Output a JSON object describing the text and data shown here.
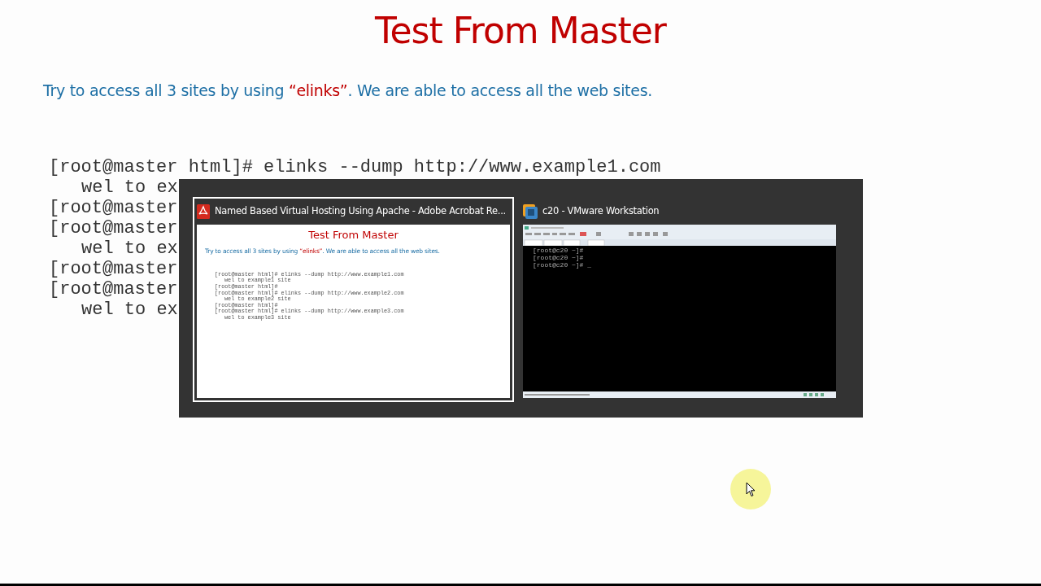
{
  "slide": {
    "title": "Test From Master",
    "subtitle": [
      {
        "text": "Try to access all 3 sites by using ",
        "highlight": false
      },
      {
        "text": "“elinks”",
        "highlight": true
      },
      {
        "text": ". We are able to access all the web sites.",
        "highlight": false
      }
    ],
    "terminal_lines": [
      {
        "text": "[root@master html]# elinks --dump http://www.example1.com",
        "indent": false
      },
      {
        "text": "wel to ex",
        "indent": true
      },
      {
        "text": "[root@master",
        "indent": false
      },
      {
        "text": "[root@master",
        "indent": false
      },
      {
        "text": "wel to ex",
        "indent": true
      },
      {
        "text": "[root@master",
        "indent": false
      },
      {
        "text": "[root@master",
        "indent": false
      },
      {
        "text": "wel to ex",
        "indent": true
      }
    ]
  },
  "task_switcher": {
    "windows": [
      {
        "kind": "pdf",
        "title": "Named Based Virtual Hosting Using Apache - Adobe Acrobat Re...",
        "selected": true,
        "preview": {
          "title": "Test From Master",
          "subtitle": [
            {
              "text": "Try to access all 3 sites by using ",
              "highlight": false
            },
            {
              "text": "“elinks”",
              "highlight": true
            },
            {
              "text": ". We are able to access all the web sites.",
              "highlight": false
            }
          ],
          "lines": [
            {
              "text": "[root@master html]# elinks --dump http://www.example1.com",
              "indent": false
            },
            {
              "text": "wel to example1 site",
              "indent": true
            },
            {
              "text": "[root@master html]#",
              "indent": false
            },
            {
              "text": "[root@master html]# elinks --dump http://www.example2.com",
              "indent": false
            },
            {
              "text": "wel to example2 site",
              "indent": true
            },
            {
              "text": "[root@master html]#",
              "indent": false
            },
            {
              "text": "[root@master html]# elinks --dump http://www.example3.com",
              "indent": false
            },
            {
              "text": "wel to example3 site",
              "indent": true
            }
          ]
        }
      },
      {
        "kind": "vmware",
        "title": "c20 - VMware Workstation",
        "selected": false,
        "preview": {
          "lines": [
            {
              "text": "[root@c20 ~]#"
            },
            {
              "text": "[root@c20 ~]#"
            },
            {
              "text": "[root@c20 ~]# _"
            }
          ]
        }
      }
    ]
  }
}
